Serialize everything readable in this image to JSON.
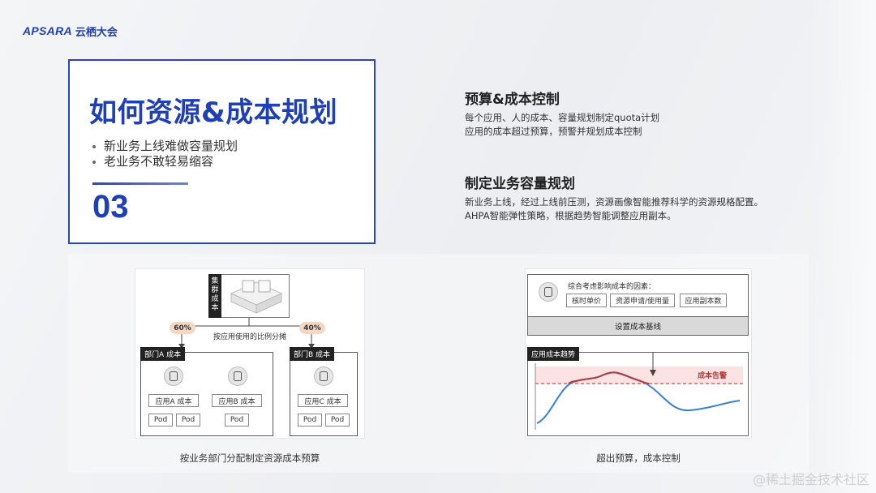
{
  "brand": {
    "mark": "APSARA",
    "name": "云栖大会"
  },
  "title_card": {
    "title": "如何资源&成本规划",
    "bullets": [
      "新业务上线难做容量规划",
      "老业务不敢轻易缩容"
    ],
    "number": "03"
  },
  "sections": [
    {
      "heading": "预算&成本控制",
      "lines": [
        "每个应用、人的成本、容量规划制定quota计划",
        "应用的成本超过预算，预警并规划成本控制"
      ]
    },
    {
      "heading": "制定业务容量规划",
      "lines": [
        "新业务上线，经过上线前压测，资源画像智能推荐科学的资源规格配置。",
        "AHPA智能弹性策略，根据趋势智能调整应用副本。"
      ]
    }
  ],
  "left_diagram": {
    "cluster_label": "集群成本",
    "split_label": "按应用使用的比例分摊",
    "pct_a": "60%",
    "pct_b": "40%",
    "dept_a": "部门A 成本",
    "dept_b": "部门B 成本",
    "app_a": "应用A 成本",
    "app_b": "应用B 成本",
    "app_c": "应用C 成本",
    "pod": "Pod",
    "caption": "按业务部门分配制定资源成本预算"
  },
  "right_diagram": {
    "factors_title": "综合考虑影响成本的因素：",
    "factors": [
      "核时单价",
      "资源申请/使用量",
      "应用副本数"
    ],
    "baseline": "设置成本基线",
    "trend_tag": "应用成本趋势",
    "alert": "成本告警",
    "caption": "超出预算，成本控制",
    "colors": {
      "line": "#3b7fd4",
      "over": "#b23a3a",
      "alert_band": "#fbe3e3"
    }
  },
  "watermark": "@稀土掘金技术社区"
}
